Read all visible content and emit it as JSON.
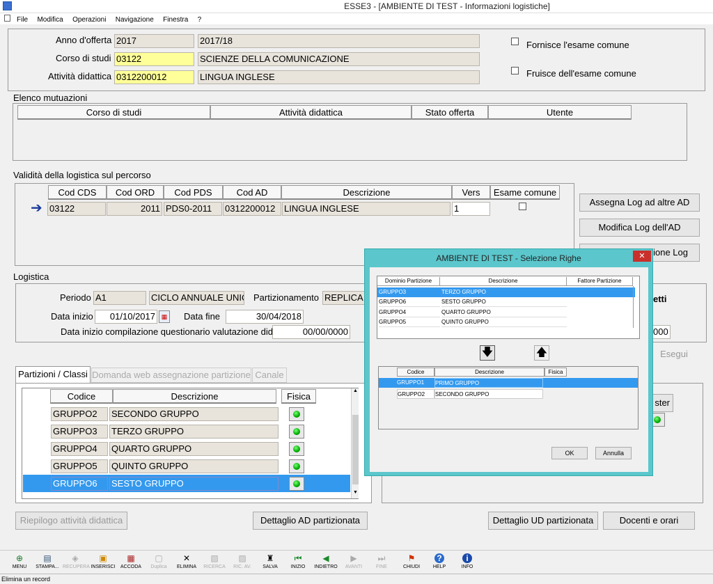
{
  "window": {
    "title": "ESSE3 - [AMBIENTE DI TEST - Informazioni logistiche]"
  },
  "menu": [
    "File",
    "Modifica",
    "Operazioni",
    "Navigazione",
    "Finestra",
    "?"
  ],
  "header": {
    "anno_label": "Anno d'offerta",
    "anno_val": "2017",
    "anno_desc": "2017/18",
    "corso_label": "Corso di studi",
    "corso_val": "03122",
    "corso_desc": "SCIENZE DELLA COMUNICAZIONE",
    "attivita_label": "Attività didattica",
    "attivita_val": "0312200012",
    "attivita_desc": "LINGUA INGLESE",
    "fornisce": "Fornisce l'esame comune",
    "fruisce": "Fruisce dell'esame comune"
  },
  "mutuazioni": {
    "title": "Elenco mutuazioni",
    "cols": [
      "Corso di studi",
      "Attività didattica",
      "Stato offerta",
      "Utente"
    ]
  },
  "validita": {
    "title": "Validità della logistica sul percorso",
    "cols": [
      "Cod CDS",
      "Cod ORD",
      "Cod PDS",
      "Cod AD",
      "Descrizione",
      "Vers",
      "Esame comune"
    ],
    "row": {
      "cds": "03122",
      "ord": "2011",
      "pds": "PDS0-2011",
      "ad": "0312200012",
      "desc": "LINGUA INGLESE",
      "vers": "1"
    }
  },
  "side_buttons": {
    "assegna": "Assegna Log ad altre AD",
    "modifica": "Modifica Log dell'AD",
    "gestione": "ione Log"
  },
  "logistica": {
    "title": "Logistica",
    "periodo_label": "Periodo",
    "periodo_val": "A1",
    "periodo_desc": "CICLO ANNUALE UNIC",
    "part_label": "Partizionamento",
    "part_val": "REPLICA A",
    "data_inizio_label": "Data inizio",
    "data_inizio": "01/10/2017",
    "data_fine_label": "Data fine",
    "data_fine": "30/04/2018",
    "quest_label": "Data inizio compilazione questionario valutazione did.",
    "quest_val": "00/00/0000",
    "etti": "etti",
    "val_000": "000",
    "esegui": "Esegui"
  },
  "tabs": [
    "Partizioni / Classi",
    "Domanda web assegnazione partizione",
    "Canale"
  ],
  "partizioni": {
    "cols": [
      "Codice",
      "Descrizione",
      "Fisica"
    ],
    "rows": [
      {
        "code": "GRUPPO2",
        "desc": "SECONDO GRUPPO"
      },
      {
        "code": "GRUPPO3",
        "desc": "TERZO GRUPPO"
      },
      {
        "code": "GRUPPO4",
        "desc": "QUARTO GRUPPO"
      },
      {
        "code": "GRUPPO5",
        "desc": "QUINTO GRUPPO"
      },
      {
        "code": "GRUPPO6",
        "desc": "SESTO GRUPPO"
      }
    ],
    "ster": "ster"
  },
  "bottom_buttons": {
    "riepilogo": "Riepilogo attività didattica",
    "dett_ad": "Dettaglio AD partizionata",
    "dett_ud": "Dettaglio UD partizionata",
    "docenti": "Docenti e orari"
  },
  "dialog": {
    "title": "AMBIENTE DI TEST - Selezione Righe",
    "close": "✕",
    "top_cols": [
      "Dominio Partizione",
      "Descrizione",
      "Fattore Partizione"
    ],
    "top_rows": [
      {
        "code": "GRUPPO3",
        "desc": "TERZO GRUPPO"
      },
      {
        "code": "GRUPPO6",
        "desc": "SESTO GRUPPO"
      },
      {
        "code": "GRUPPO4",
        "desc": "QUARTO GRUPPO"
      },
      {
        "code": "GRUPPO5",
        "desc": "QUINTO GRUPPO"
      }
    ],
    "bottom_cols": [
      "Codice",
      "Descrizione",
      "Fisica"
    ],
    "bottom_rows": [
      {
        "code": "GRUPPO1",
        "desc": "PRIMO GRUPPO"
      },
      {
        "code": "GRUPPO2",
        "desc": "SECONDO GRUPPO"
      }
    ],
    "ok": "OK",
    "annulla": "Annulla"
  },
  "toolbar": [
    {
      "label": "MENU",
      "icon": "⊕"
    },
    {
      "label": "STAMPA...",
      "icon": "▤"
    },
    {
      "label": "RECUPERA",
      "icon": "◈"
    },
    {
      "label": "INSERISCI",
      "icon": "▣"
    },
    {
      "label": "ACCODA",
      "icon": "▦"
    },
    {
      "label": "Duplica",
      "icon": "▢"
    },
    {
      "label": "ELIMINA",
      "icon": "✕"
    },
    {
      "label": "RICERCA",
      "icon": "▧"
    },
    {
      "label": "RIC. AV.",
      "icon": "▨"
    },
    {
      "label": "SALVA",
      "icon": "♜"
    },
    {
      "label": "INIZIO",
      "icon": "⏮"
    },
    {
      "label": "INDIETRO",
      "icon": "◀"
    },
    {
      "label": "AVANTI",
      "icon": "▶"
    },
    {
      "label": "FINE",
      "icon": "⏭"
    },
    {
      "label": "CHIUDI",
      "icon": "⚑"
    },
    {
      "label": "HELP",
      "icon": "?"
    },
    {
      "label": "INFO",
      "icon": "i"
    }
  ],
  "status": "Elimina un record"
}
